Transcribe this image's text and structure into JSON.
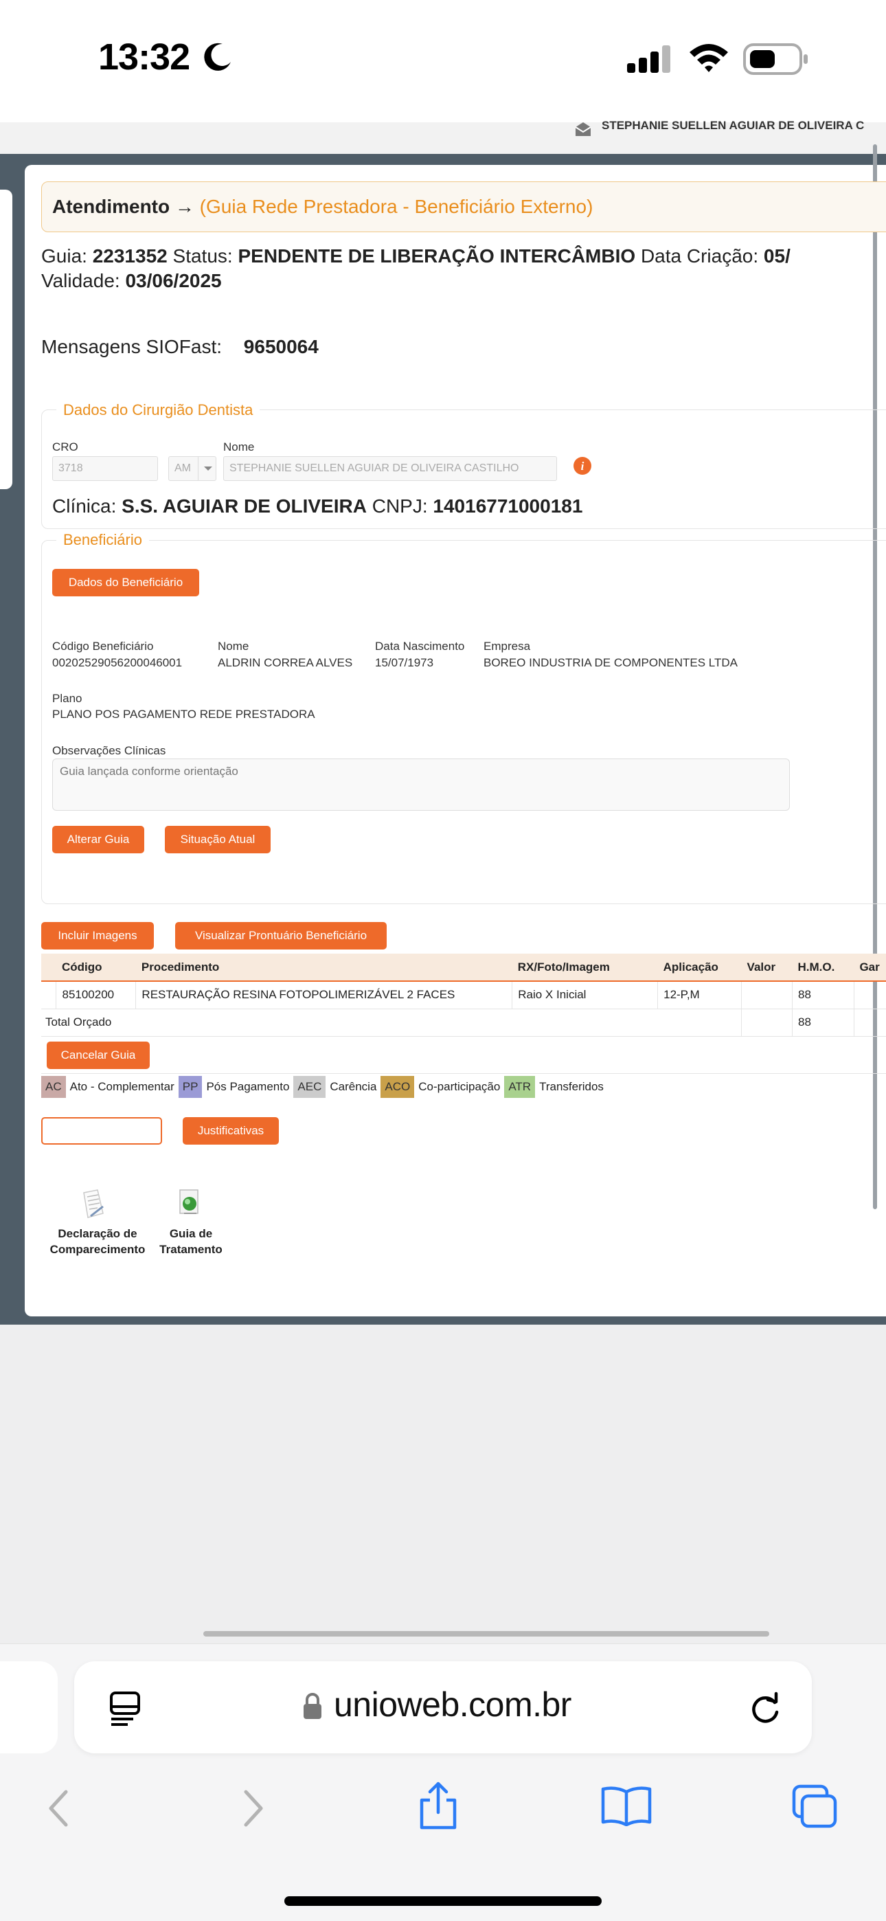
{
  "status_bar": {
    "time": "13:32"
  },
  "user": {
    "name": "STEPHANIE SUELLEN AGUIAR DE OLIVEIRA C"
  },
  "header": {
    "title": "Atendimento",
    "arrow": "→",
    "subtitle": "(Guia Rede Prestadora - Beneficiário Externo)"
  },
  "guia": {
    "guia_label": "Guia:",
    "guia_value": "2231352",
    "status_label": "Status:",
    "status_value": "PENDENTE DE LIBERAÇÃO INTERCÂMBIO",
    "criacao_label": "Data Criação:",
    "criacao_value": "05/",
    "validade_label": "Validade:",
    "validade_value": "03/06/2025"
  },
  "mensagens": {
    "label": "Mensagens SIOFast:",
    "value": "9650064"
  },
  "dentista": {
    "legend": "Dados do Cirurgião Dentista",
    "cro_label": "CRO",
    "cro_value": "3718",
    "uf_value": "AM",
    "nome_label": "Nome",
    "nome_value": "STEPHANIE SUELLEN AGUIAR DE OLIVEIRA CASTILHO",
    "clinica_label": "Clínica:",
    "clinica_value": "S.S. AGUIAR DE OLIVEIRA",
    "cnpj_label": "CNPJ:",
    "cnpj_value": "14016771000181"
  },
  "beneficiario": {
    "legend": "Beneficiário",
    "dados_button": "Dados do Beneficiário",
    "codigo_label": "Código Beneficiário",
    "codigo_value": "00202529056200046001",
    "nome_label": "Nome",
    "nome_value": "ALDRIN CORREA ALVES",
    "nasc_label": "Data Nascimento",
    "nasc_value": "15/07/1973",
    "empresa_label": "Empresa",
    "empresa_value": "BOREO INDUSTRIA DE COMPONENTES LTDA",
    "plano_label": "Plano",
    "plano_value": "PLANO POS PAGAMENTO REDE PRESTADORA",
    "obs_label": "Observações Clínicas",
    "obs_value": "Guia lançada conforme orientação",
    "alterar_button": "Alterar Guia",
    "situacao_button": "Situação Atual"
  },
  "actions": {
    "incluir_imagens": "Incluir Imagens",
    "visualizar_prontuario": "Visualizar Prontuário Beneficiário"
  },
  "table": {
    "headers": [
      "",
      "Código",
      "Procedimento",
      "RX/Foto/Imagem",
      "Aplicação",
      "Valor",
      "H.M.O.",
      "Gar"
    ],
    "rows": [
      [
        "",
        "85100200",
        "RESTAURAÇÃO RESINA FOTOPOLIMERIZÁVEL 2 FACES",
        "Raio X Inicial",
        "12-P,M",
        "",
        "88",
        ""
      ]
    ],
    "total_label": "Total Orçado",
    "total_hmo": "88"
  },
  "cancelar_button": "Cancelar Guia",
  "legend_items": [
    {
      "code": "AC",
      "label": "Ato - Complementar",
      "color": "#c9a9a6"
    },
    {
      "code": "PP",
      "label": "Pós Pagamento",
      "color": "#9b9bd6"
    },
    {
      "code": "AEC",
      "label": "Carência",
      "color": "#cccccc"
    },
    {
      "code": "ACO",
      "label": "Co-participação",
      "color": "#c9a04a"
    },
    {
      "code": "ATR",
      "label": "Transferidos",
      "color": "#a9d18e"
    }
  ],
  "justificativas_button": "Justificativas",
  "docs": [
    {
      "line1": "Declaração de",
      "line2": "Comparecimento",
      "icon": "document-icon"
    },
    {
      "line1": "Guia de",
      "line2": "Tratamento",
      "icon": "treatment-guide-icon"
    }
  ],
  "browser": {
    "url": "unioweb.com.br"
  }
}
